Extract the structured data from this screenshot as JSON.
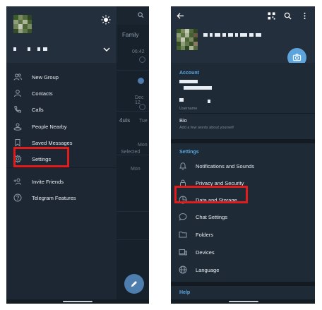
{
  "left": {
    "chats_header": "Family",
    "chat_fragments": [
      "06:42",
      "Dec 12",
      "4uts",
      "Tue",
      "Mon",
      "Selected",
      "Mon"
    ],
    "menu": [
      {
        "label": "New Group",
        "icon": "group-icon"
      },
      {
        "label": "Contacts",
        "icon": "contact-icon"
      },
      {
        "label": "Calls",
        "icon": "phone-icon"
      },
      {
        "label": "People Nearby",
        "icon": "nearby-icon"
      },
      {
        "label": "Saved Messages",
        "icon": "bookmark-icon"
      },
      {
        "label": "Settings",
        "icon": "gear-icon"
      },
      {
        "label": "Invite Friends",
        "icon": "add-user-icon"
      },
      {
        "label": "Telegram Features",
        "icon": "question-icon"
      }
    ]
  },
  "right": {
    "account": {
      "title": "Account",
      "username_label": "Username",
      "bio_label": "Bio",
      "bio_placeholder": "Add a few words about yourself"
    },
    "settings": {
      "title": "Settings",
      "items": [
        {
          "label": "Notifications and Sounds",
          "icon": "bell-icon"
        },
        {
          "label": "Privacy and Security",
          "icon": "lock-icon"
        },
        {
          "label": "Data and Storage",
          "icon": "pie-chart-icon"
        },
        {
          "label": "Chat Settings",
          "icon": "chat-bubble-icon"
        },
        {
          "label": "Folders",
          "icon": "folder-icon"
        },
        {
          "label": "Devices",
          "icon": "devices-icon"
        },
        {
          "label": "Language",
          "icon": "globe-icon"
        }
      ]
    },
    "help_title": "Help"
  },
  "colors": {
    "accent": "#5ba7e1",
    "highlight": "#e31b1b",
    "drawer_bg": "#1d2733",
    "header_bg": "#242f3d"
  }
}
